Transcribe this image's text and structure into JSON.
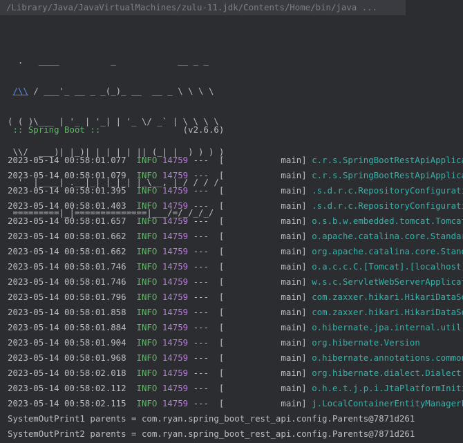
{
  "command": "/Library/Java/JavaVirtualMachines/zulu-11.jdk/Contents/Home/bin/java ...",
  "banner": {
    "line1": "  .   ____          _            __ _ _",
    "line2a": " ",
    "line2blue": "/\\\\",
    "line2b": " / ___'_ __ _ _(_)_ __  __ _ \\ \\ \\ \\",
    "line3": "( ( )\\___ | '_ | '_| | '_ \\/ _` | \\ \\ \\ \\",
    "line4": " \\\\/  ___)| |_)| | | | | || (_| |  ) ) ) )",
    "line5": "  '  |____| .__|_| |_|_| |_\\__, | / / / /",
    "line6": " =========|_|==============|___/=/_/_/_/"
  },
  "spring": {
    "label": " :: Spring Boot :: ",
    "padding": "              ",
    "version": " (v2.6.6)"
  },
  "log_rows": [
    {
      "date": "2023-05-14 00:58:01.077",
      "level": "INFO",
      "pid": "14759",
      "thread": "---  [           main]",
      "logger": "c.r.s.SpringBootRestApiApplication"
    },
    {
      "date": "2023-05-14 00:58:01.079",
      "level": "INFO",
      "pid": "14759",
      "thread": "---  [           main]",
      "logger": "c.r.s.SpringBootRestApiApplication"
    },
    {
      "date": "2023-05-14 00:58:01.395",
      "level": "INFO",
      "pid": "14759",
      "thread": "---  [           main]",
      "logger": ".s.d.r.c.RepositoryConfigurationDelegate"
    },
    {
      "date": "2023-05-14 00:58:01.403",
      "level": "INFO",
      "pid": "14759",
      "thread": "---  [           main]",
      "logger": ".s.d.r.c.RepositoryConfigurationDelegate"
    },
    {
      "date": "2023-05-14 00:58:01.657",
      "level": "INFO",
      "pid": "14759",
      "thread": "---  [           main]",
      "logger": "o.s.b.w.embedded.tomcat.TomcatWebServer"
    },
    {
      "date": "2023-05-14 00:58:01.662",
      "level": "INFO",
      "pid": "14759",
      "thread": "---  [           main]",
      "logger": "o.apache.catalina.core.StandardService"
    },
    {
      "date": "2023-05-14 00:58:01.662",
      "level": "INFO",
      "pid": "14759",
      "thread": "---  [           main]",
      "logger": "org.apache.catalina.core.StandardEngine"
    },
    {
      "date": "2023-05-14 00:58:01.746",
      "level": "INFO",
      "pid": "14759",
      "thread": "---  [           main]",
      "logger": "o.a.c.c.C.[Tomcat].[localhost].[/]"
    },
    {
      "date": "2023-05-14 00:58:01.746",
      "level": "INFO",
      "pid": "14759",
      "thread": "---  [           main]",
      "logger": "w.s.c.ServletWebServerApplicationContext"
    },
    {
      "date": "2023-05-14 00:58:01.796",
      "level": "INFO",
      "pid": "14759",
      "thread": "---  [           main]",
      "logger": "com.zaxxer.hikari.HikariDataSource"
    },
    {
      "date": "2023-05-14 00:58:01.858",
      "level": "INFO",
      "pid": "14759",
      "thread": "---  [           main]",
      "logger": "com.zaxxer.hikari.HikariDataSource"
    },
    {
      "date": "2023-05-14 00:58:01.884",
      "level": "INFO",
      "pid": "14759",
      "thread": "---  [           main]",
      "logger": "o.hibernate.jpa.internal.util.LogHelper"
    },
    {
      "date": "2023-05-14 00:58:01.904",
      "level": "INFO",
      "pid": "14759",
      "thread": "---  [           main]",
      "logger": "org.hibernate.Version"
    },
    {
      "date": "2023-05-14 00:58:01.968",
      "level": "INFO",
      "pid": "14759",
      "thread": "---  [           main]",
      "logger": "o.hibernate.annotations.common.Version"
    },
    {
      "date": "2023-05-14 00:58:02.018",
      "level": "INFO",
      "pid": "14759",
      "thread": "---  [           main]",
      "logger": "org.hibernate.dialect.Dialect"
    },
    {
      "date": "2023-05-14 00:58:02.112",
      "level": "INFO",
      "pid": "14759",
      "thread": "---  [           main]",
      "logger": "o.h.e.t.j.p.i.JtaPlatformInitiator"
    },
    {
      "date": "2023-05-14 00:58:02.115",
      "level": "INFO",
      "pid": "14759",
      "thread": "---  [           main]",
      "logger": "j.LocalContainerEntityManagerFactoryBean"
    }
  ],
  "stdout_lines": [
    "SystemOutPrint1 parents = com.ryan.spring_boot_rest_api.config.Parents@7871d261",
    "SystemOutPrint2 parents = com.ryan.spring_boot_rest_api.config.Parents@7871d261"
  ],
  "colors": {
    "background": "#2b2d30",
    "info": "#5fb865",
    "pid": "#b77fd6",
    "logger": "#2fb5ac",
    "link": "#548af7"
  }
}
